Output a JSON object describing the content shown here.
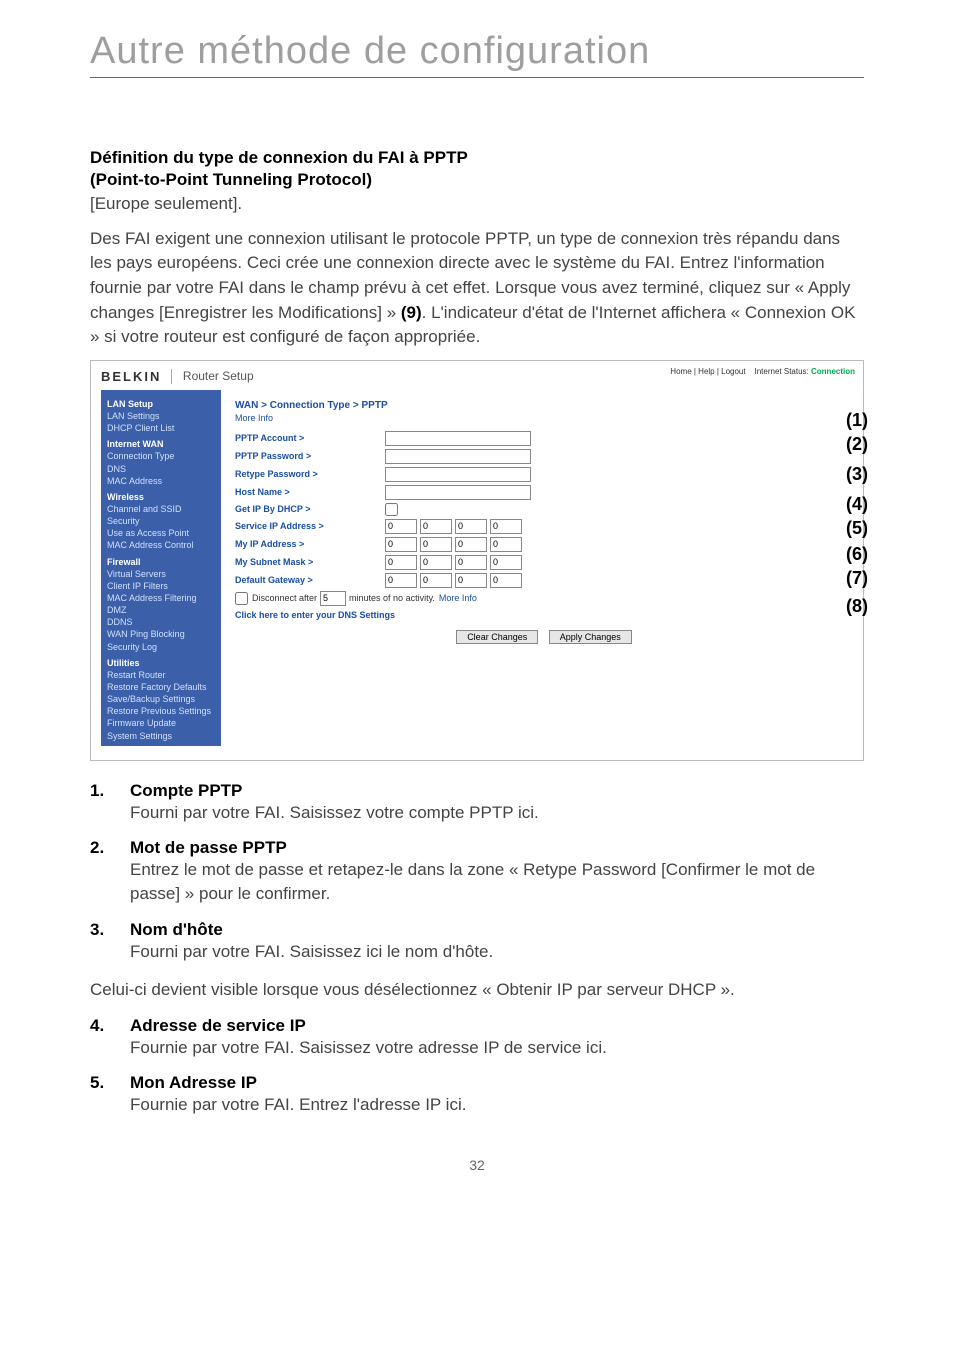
{
  "title": "Autre méthode de configuration",
  "heading1": "Définition du type de connexion du FAI à PPTP",
  "heading2": "(Point-to-Point Tunneling Protocol)",
  "europe_only": "[Europe seulement].",
  "intro": "Des FAI exigent une connexion utilisant le protocole PPTP, un type de connexion très répandu dans les pays européens. Ceci crée une connexion directe avec le système du FAI. Entrez l'information fournie par votre FAI dans le champ prévu à cet effet. Lorsque vous avez terminé, cliquez sur « Apply changes [Enregistrer les Modifications] » ",
  "intro_bold": "(9)",
  "intro_cont": ". L'indicateur d'état de l'Internet affichera « Connexion OK » si votre routeur est configuré de façon appropriée.",
  "shot": {
    "brand": "BELKIN",
    "setup": "Router Setup",
    "toplinks_left": "Home | Help | Logout",
    "toplinks_status_label": "Internet Status:",
    "toplinks_status_value": "Connection",
    "crumb": "WAN > Connection Type > PPTP",
    "moreinfo": "More Info",
    "sidebar": {
      "groups": [
        {
          "head": "LAN Setup",
          "items": [
            "LAN Settings",
            "DHCP Client List"
          ]
        },
        {
          "head": "Internet WAN",
          "items": [
            "Connection Type",
            "DNS",
            "MAC Address"
          ]
        },
        {
          "head": "Wireless",
          "items": [
            "Channel and SSID",
            "Security",
            "Use as Access Point",
            "MAC Address Control"
          ]
        },
        {
          "head": "Firewall",
          "items": [
            "Virtual Servers",
            "Client IP Filters",
            "MAC Address Filtering",
            "DMZ",
            "DDNS",
            "WAN Ping Blocking",
            "Security Log"
          ]
        },
        {
          "head": "Utilities",
          "items": [
            "Restart Router",
            "Restore Factory Defaults",
            "Save/Backup Settings",
            "Restore Previous Settings",
            "Firmware Update",
            "System Settings"
          ]
        }
      ]
    },
    "labels": {
      "pptp_account": "PPTP Account >",
      "pptp_password": "PPTP Password >",
      "retype_password": "Retype Password >",
      "host_name": "Host Name >",
      "get_ip_dhcp": "Get IP By DHCP >",
      "service_ip": "Service IP Address >",
      "my_ip": "My IP Address >",
      "subnet": "My Subnet Mask >",
      "gateway": "Default Gateway >",
      "disconnect": "Disconnect after",
      "disconnect_suffix": "minutes of no activity.",
      "disconnect_more": "More Info",
      "dns_link": "Click here to enter your DNS Settings",
      "clear": "Clear Changes",
      "apply": "Apply Changes"
    },
    "ip_default": "0",
    "disconnect_minutes": "5"
  },
  "callouts": [
    "(1)",
    "(2)",
    "(3)",
    "(4)",
    "(5)",
    "(6)",
    "(7)",
    "(8)"
  ],
  "list": [
    {
      "n": "1.",
      "h": "Compte PPTP",
      "p": "Fourni par votre FAI. Saisissez votre compte PPTP ici."
    },
    {
      "n": "2.",
      "h": "Mot de passe PPTP",
      "p": "Entrez le mot de passe et retapez-le dans la zone « Retype Password [Confirmer le mot de passe] » pour le confirmer."
    },
    {
      "n": "3.",
      "h": "Nom d'hôte",
      "p": "Fourni par votre FAI. Saisissez ici le nom d'hôte."
    }
  ],
  "note": "Celui-ci devient visible lorsque vous désélectionnez « Obtenir IP par serveur DHCP ».",
  "list2": [
    {
      "n": "4.",
      "h": "Adresse de service IP",
      "p": "Fournie par votre FAI. Saisissez votre adresse IP de service ici."
    },
    {
      "n": "5.",
      "h": "Mon Adresse IP",
      "p": "Fournie par votre FAI. Entrez l'adresse IP ici."
    }
  ],
  "page_number": "32"
}
